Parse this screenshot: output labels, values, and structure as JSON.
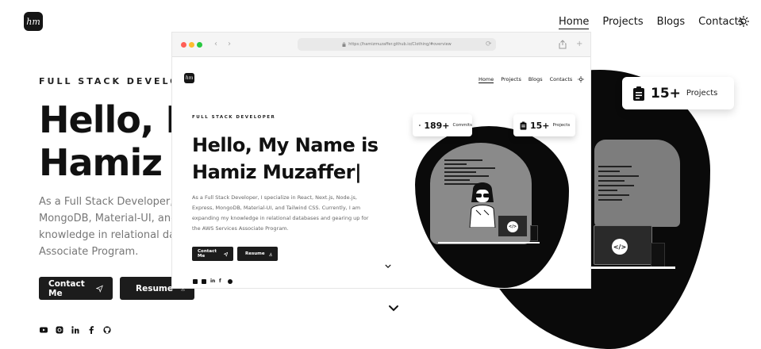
{
  "background_page": {
    "logo_text": "hm",
    "nav": {
      "home": "Home",
      "projects": "Projects",
      "blogs": "Blogs",
      "contacts": "Contacts"
    },
    "subtitle": "FULL STACK DEVELOPER",
    "heading_line1": "Hello, My",
    "heading_line2": "Hamiz M",
    "paragraph_line1": "As a Full Stack Developer, I sp",
    "paragraph_line2": "MongoDB, Material-UI, and T",
    "paragraph_line3": "knowledge in relational datab",
    "paragraph_line4": "Associate Program.",
    "contact_button": "Contact Me",
    "resume_button": "Resume",
    "projects_card": {
      "count": "15+",
      "label": "Projects"
    }
  },
  "browser": {
    "url": "https://hamizmuzaffer.github.io/Clothing/#overview",
    "logo_text": "hm",
    "nav": {
      "home": "Home",
      "projects": "Projects",
      "blogs": "Blogs",
      "contacts": "Contacts"
    },
    "subtitle": "FULL STACK DEVELOPER",
    "heading_line1": "Hello, My Name is",
    "heading_line2": "Hamiz Muzaffer|",
    "paragraph": "As a Full Stack Developer, I specialize in React, Next.js, Node.js, Express, MongoDB, Material-UI, and Tailwind CSS. Currently, I am expanding my knowledge in relational databases and gearing up for the AWS Services Associate Program.",
    "contact_button": "Contact Me",
    "resume_button": "Resume",
    "commits_card": {
      "count": "189+",
      "label": "Commits"
    },
    "projects_card": {
      "count": "15+",
      "label": "Projects"
    },
    "laptop_code": "</>"
  },
  "colors": {
    "dark": "#151515",
    "muted_text": "#777777",
    "blob": "#0a0a0a"
  },
  "icons": [
    "youtube-icon",
    "instagram-icon",
    "linkedin-icon",
    "facebook-icon",
    "github-icon",
    "sun-icon",
    "send-icon",
    "download-icon",
    "chevron-down-icon"
  ]
}
